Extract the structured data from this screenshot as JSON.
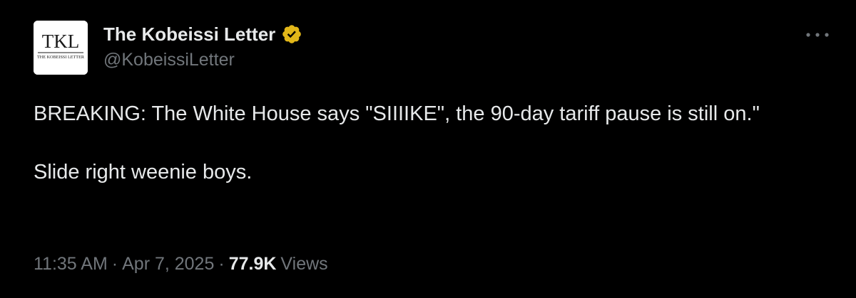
{
  "author": {
    "display_name": "The Kobeissi Letter",
    "handle": "@KobeissiLetter",
    "avatar": {
      "monogram": "TKL",
      "subtitle": "THE KOBEISSI LETTER"
    },
    "verified_icon": "verified-badge-icon",
    "verified_color": "#e2b719"
  },
  "tweet": {
    "paragraphs": [
      "BREAKING: The White House says \"SIIIIKE\", the 90-day tariff pause is still on.\"",
      "Slide right weenie boys."
    ]
  },
  "meta": {
    "time": "11:35 AM",
    "separator": "·",
    "date": "Apr 7, 2025",
    "views_count": "77.9K",
    "views_label": "Views"
  },
  "more_icon": "more-options-icon",
  "colors": {
    "background": "#000000",
    "primary_text": "#e7e9ea",
    "secondary_text": "#71767b"
  }
}
